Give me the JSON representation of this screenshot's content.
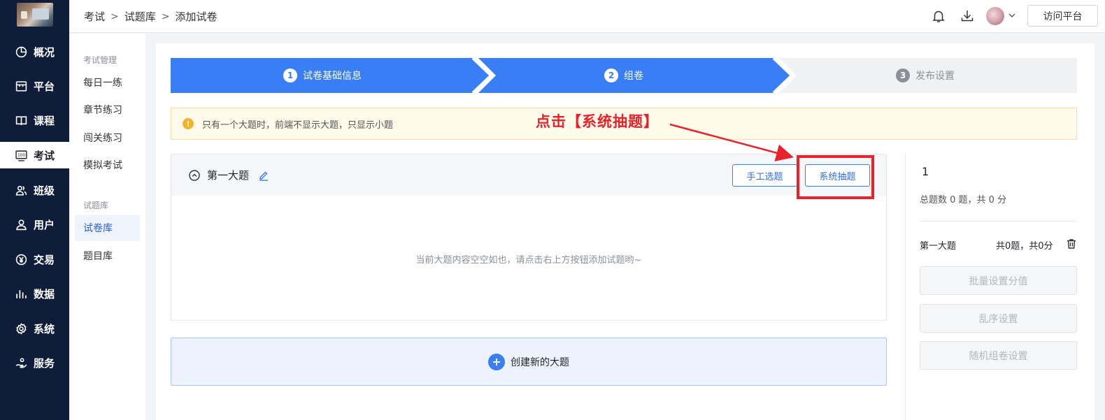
{
  "rail": {
    "items": [
      {
        "label": "概况",
        "icon": "pie-chart-icon"
      },
      {
        "label": "平台",
        "icon": "storefront-icon"
      },
      {
        "label": "课程",
        "icon": "book-icon"
      },
      {
        "label": "考试",
        "icon": "exam-100-icon"
      },
      {
        "label": "班级",
        "icon": "group-icon"
      },
      {
        "label": "用户",
        "icon": "user-icon"
      },
      {
        "label": "交易",
        "icon": "yen-circle-icon"
      },
      {
        "label": "数据",
        "icon": "bar-chart-icon"
      },
      {
        "label": "系统",
        "icon": "gear-icon"
      },
      {
        "label": "服务",
        "icon": "service-hand-icon"
      }
    ]
  },
  "header": {
    "breadcrumb": [
      "考试",
      "试题库",
      "添加试卷"
    ],
    "visit_label": "访问平台"
  },
  "subnav": {
    "group1": "考试管理",
    "group1_items": [
      "每日一练",
      "章节练习",
      "闯关练习",
      "模拟考试"
    ],
    "group2": "试题库",
    "group2_items": [
      "试卷库",
      "题目库"
    ]
  },
  "steps": [
    {
      "num": "1",
      "label": "试卷基础信息"
    },
    {
      "num": "2",
      "label": "组卷"
    },
    {
      "num": "3",
      "label": "发布设置"
    }
  ],
  "notice": "只有一个大题时，前端不显示大题，只显示小题",
  "annotation": "点击【系统抽题】",
  "section": {
    "title": "第一大题",
    "manual_button": "手工选题",
    "system_button": "系统抽题",
    "empty_tip": "当前大题内容空空如也，请点击右上方按钮添加试题哟~"
  },
  "add_section_label": "创建新的大题",
  "right_panel": {
    "count": "1",
    "total": "总题数 0 题，共 0 分",
    "row_name": "第一大题",
    "row_score": "共0题，共0分",
    "buttons": [
      "批量设置分值",
      "乱序设置",
      "随机组卷设置"
    ]
  },
  "colors": {
    "rail_bg": "#0f1d3a",
    "primary": "#3a7ef5",
    "annotation_red": "#e8222b"
  }
}
